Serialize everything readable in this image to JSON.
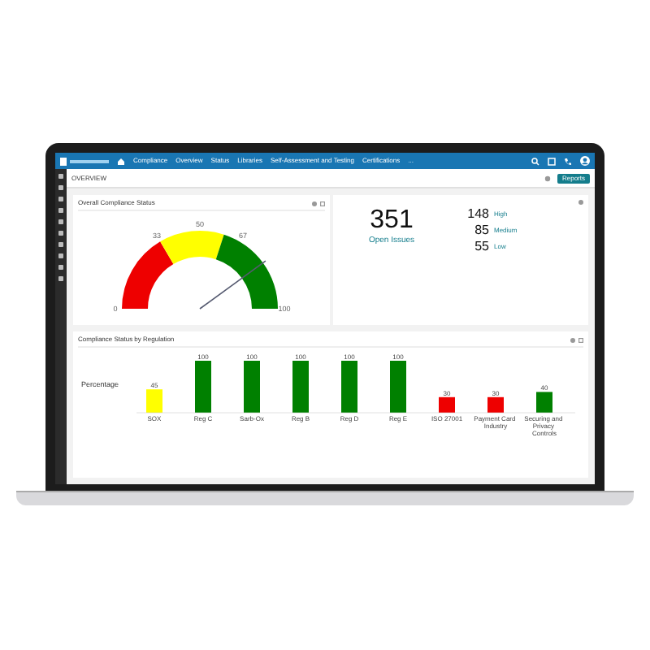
{
  "nav": {
    "items": [
      "Compliance",
      "Overview",
      "Status",
      "Libraries",
      "Self-Assessment and Testing",
      "Certifications",
      "..."
    ]
  },
  "header": {
    "title": "OVERVIEW",
    "button": "Reports"
  },
  "gauge_panel": {
    "title": "Overall Compliance Status",
    "ticks": [
      "0",
      "33",
      "50",
      "67",
      "100"
    ]
  },
  "issues_panel": {
    "total": "351",
    "total_label": "Open Issues",
    "rows": [
      {
        "count": "148",
        "label": "High"
      },
      {
        "count": "85",
        "label": "Medium"
      },
      {
        "count": "55",
        "label": "Low"
      }
    ]
  },
  "regulation_panel": {
    "title": "Compliance Status by Regulation",
    "chart_data": {
      "type": "bar",
      "ylabel": "Percentage",
      "categories": [
        "SOX",
        "Reg C",
        "Sarb-Ox",
        "Reg B",
        "Reg D",
        "Reg E",
        "ISO 27001",
        "Payment Card Industry",
        "Securing and Privacy Controls"
      ],
      "data_labels": true,
      "series": [
        {
          "values": [
            45,
            100,
            100,
            100,
            100,
            100,
            30,
            30,
            40
          ]
        }
      ]
    }
  }
}
